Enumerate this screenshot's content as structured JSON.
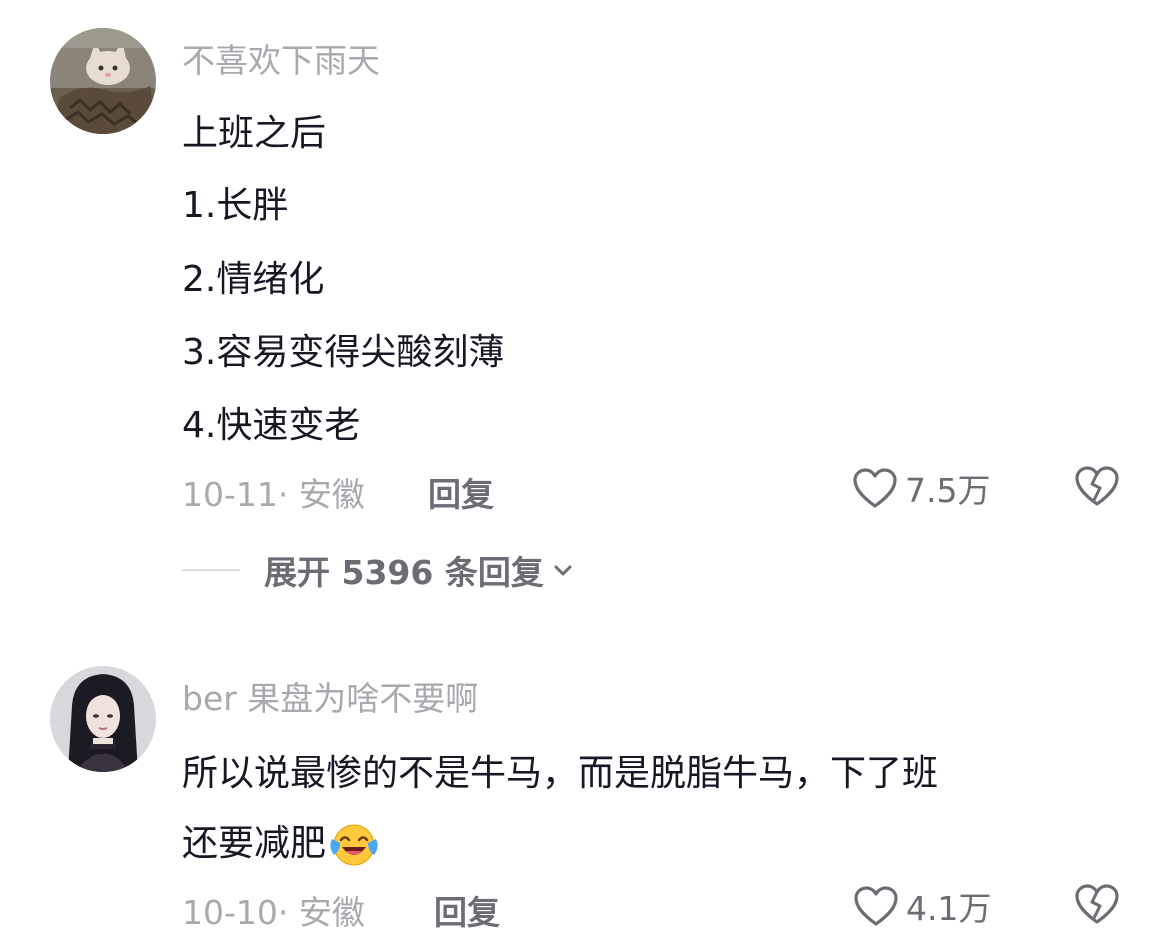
{
  "comments": [
    {
      "username": "不喜欢下雨天",
      "avatar_icon": "cat-avatar-icon",
      "lines": [
        "上班之后",
        "1.长胖",
        "2.情绪化",
        "3.容易变得尖酸刻薄",
        "4.快速变老"
      ],
      "date_location": "10-11· 安徽",
      "reply_label": "回复",
      "likes": "7.5万",
      "expand_label": "展开 5396 条回复"
    },
    {
      "username": "ber 果盘为啥不要啊",
      "avatar_icon": "woman-avatar-icon",
      "lines": [
        "所以说最惨的不是牛马，而是脱脂牛马，下了班",
        "还要减肥"
      ],
      "emoji": "crying-laughing-emoji",
      "date_location": "10-10· 安徽",
      "reply_label": "回复",
      "likes": "4.1万"
    }
  ],
  "colors": {
    "primary_text": "#161823",
    "secondary_text": "#a8a9ae",
    "action_text": "#6c6d74"
  }
}
